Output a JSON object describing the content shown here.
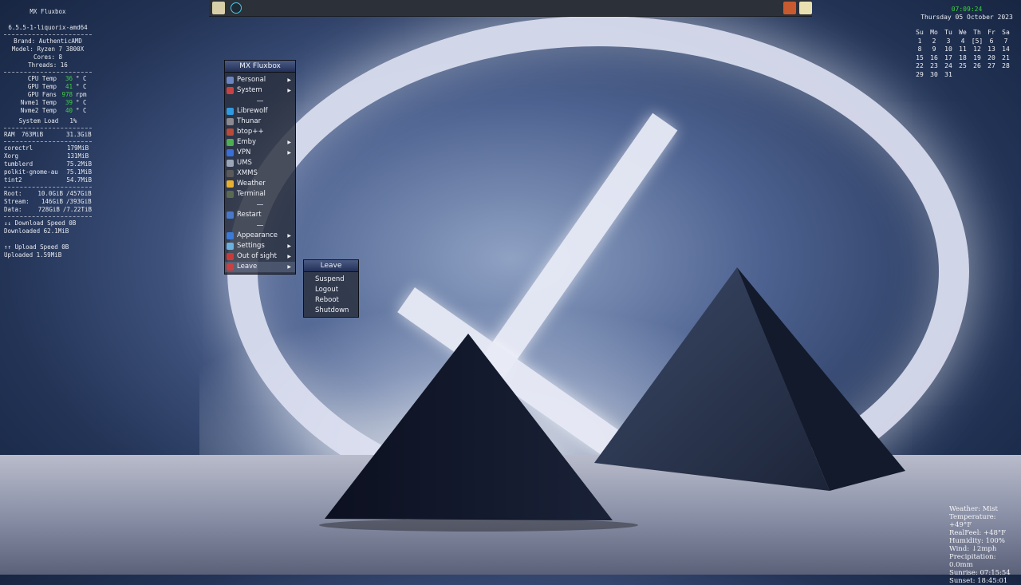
{
  "conky": {
    "host": "MX Fluxbox",
    "kernel": "6.5.5-1-liquorix-amd64",
    "brand": "Brand: AuthenticAMD",
    "model": "Model: Ryzen 7 3800X",
    "cores": "Cores: 8",
    "threads": "Threads: 16",
    "temps": [
      {
        "label": "CPU Temp",
        "value": "36",
        "unit": "° C"
      },
      {
        "label": "GPU Temp",
        "value": "41",
        "unit": "° C"
      },
      {
        "label": "GPU Fans",
        "value": "978",
        "unit": "rpm"
      },
      {
        "label": "Nvme1 Temp",
        "value": "39",
        "unit": "° C"
      },
      {
        "label": "Nvme2 Temp",
        "value": "40",
        "unit": "° C"
      }
    ],
    "system_load_label": "System Load",
    "system_load": "1%",
    "ram_label": "RAM",
    "ram_used": "763MiB",
    "ram_total": "31.3GiB",
    "processes": [
      {
        "name": "corectrl",
        "mem": "179MiB"
      },
      {
        "name": "Xorg",
        "mem": "131MiB"
      },
      {
        "name": "tumblerd",
        "mem": "75.2MiB"
      },
      {
        "name": "polkit-gnome-au",
        "mem": "75.1MiB"
      },
      {
        "name": "tint2",
        "mem": "54.7MiB"
      }
    ],
    "disks": [
      {
        "name": "Root:",
        "used": "10.0GiB",
        "total": "/457GiB"
      },
      {
        "name": "Stream:",
        "used": "146GiB",
        "total": "/393GiB"
      },
      {
        "name": "Data:",
        "used": "728GiB",
        "total": "/7.22TiB"
      }
    ],
    "download_speed": "↓↓ Download Speed 0B",
    "downloaded": "Downloaded 62.1MiB",
    "upload_speed": "↑↑ Upload Speed 0B",
    "uploaded": "Uploaded 1.59MiB"
  },
  "clock": {
    "time": "07:09:24",
    "date": "Thursday 05 October 2023"
  },
  "calendar": {
    "headers": [
      "Su",
      "Mo",
      "Tu",
      "We",
      "Th",
      "Fr",
      "Sa"
    ],
    "weeks": [
      [
        "1",
        "2",
        "3",
        "4",
        "[5]",
        "6",
        "7"
      ],
      [
        "8",
        "9",
        "10",
        "11",
        "12",
        "13",
        "14"
      ],
      [
        "15",
        "16",
        "17",
        "18",
        "19",
        "20",
        "21"
      ],
      [
        "22",
        "23",
        "24",
        "25",
        "26",
        "27",
        "28"
      ],
      [
        "29",
        "30",
        "31",
        "",
        "",
        "",
        ""
      ]
    ]
  },
  "weather": {
    "lines": [
      "Weather: Mist",
      "Temperature: +49°F",
      "RealFeel: +48°F",
      "Humidity: 100%",
      "Wind: ↓2mph",
      "Precipitation: 0.0mm",
      "Sunrise: 07:15:54",
      "Sunset: 18:45:01"
    ]
  },
  "root_menu": {
    "title": "MX Fluxbox",
    "items": [
      {
        "label": "Personal",
        "icon": "personal-icon",
        "color": "#6c86c4",
        "submenu": true
      },
      {
        "label": "System",
        "icon": "system-icon",
        "color": "#c84242",
        "submenu": true
      },
      {
        "label": "Librewolf",
        "icon": "librewolf-icon",
        "color": "#2f9ae0",
        "submenu": false
      },
      {
        "label": "Thunar",
        "icon": "thunar-icon",
        "color": "#8a8a90",
        "submenu": false
      },
      {
        "label": "btop++",
        "icon": "btop-icon",
        "color": "#b84a3a",
        "submenu": false
      },
      {
        "label": "Emby",
        "icon": "emby-icon",
        "color": "#4caf50",
        "submenu": true
      },
      {
        "label": "VPN",
        "icon": "vpn-icon",
        "color": "#3a6fd8",
        "submenu": true
      },
      {
        "label": "UMS",
        "icon": "ums-icon",
        "color": "#9aa6b8",
        "submenu": false
      },
      {
        "label": "XMMS",
        "icon": "xmms-icon",
        "color": "#5a5a5a",
        "submenu": false
      },
      {
        "label": "Weather",
        "icon": "weather-icon",
        "color": "#e8b030",
        "submenu": false
      },
      {
        "label": "Terminal",
        "icon": "terminal-icon",
        "color": "#5a6a50",
        "submenu": false
      },
      {
        "label": "Restart",
        "icon": "restart-icon",
        "color": "#4a78c8",
        "submenu": false
      },
      {
        "label": "Appearance",
        "icon": "appearance-icon",
        "color": "#3a7ad8",
        "submenu": true
      },
      {
        "label": "Settings",
        "icon": "settings-icon",
        "color": "#6ab0e0",
        "submenu": true
      },
      {
        "label": "Out of sight",
        "icon": "out-of-sight-icon",
        "color": "#c83a3a",
        "submenu": true
      },
      {
        "label": "Leave",
        "icon": "leave-icon",
        "color": "#c84040",
        "submenu": true
      }
    ]
  },
  "leave_menu": {
    "title": "Leave",
    "items": [
      "Suspend",
      "Logout",
      "Reboot",
      "Shutdown"
    ]
  }
}
